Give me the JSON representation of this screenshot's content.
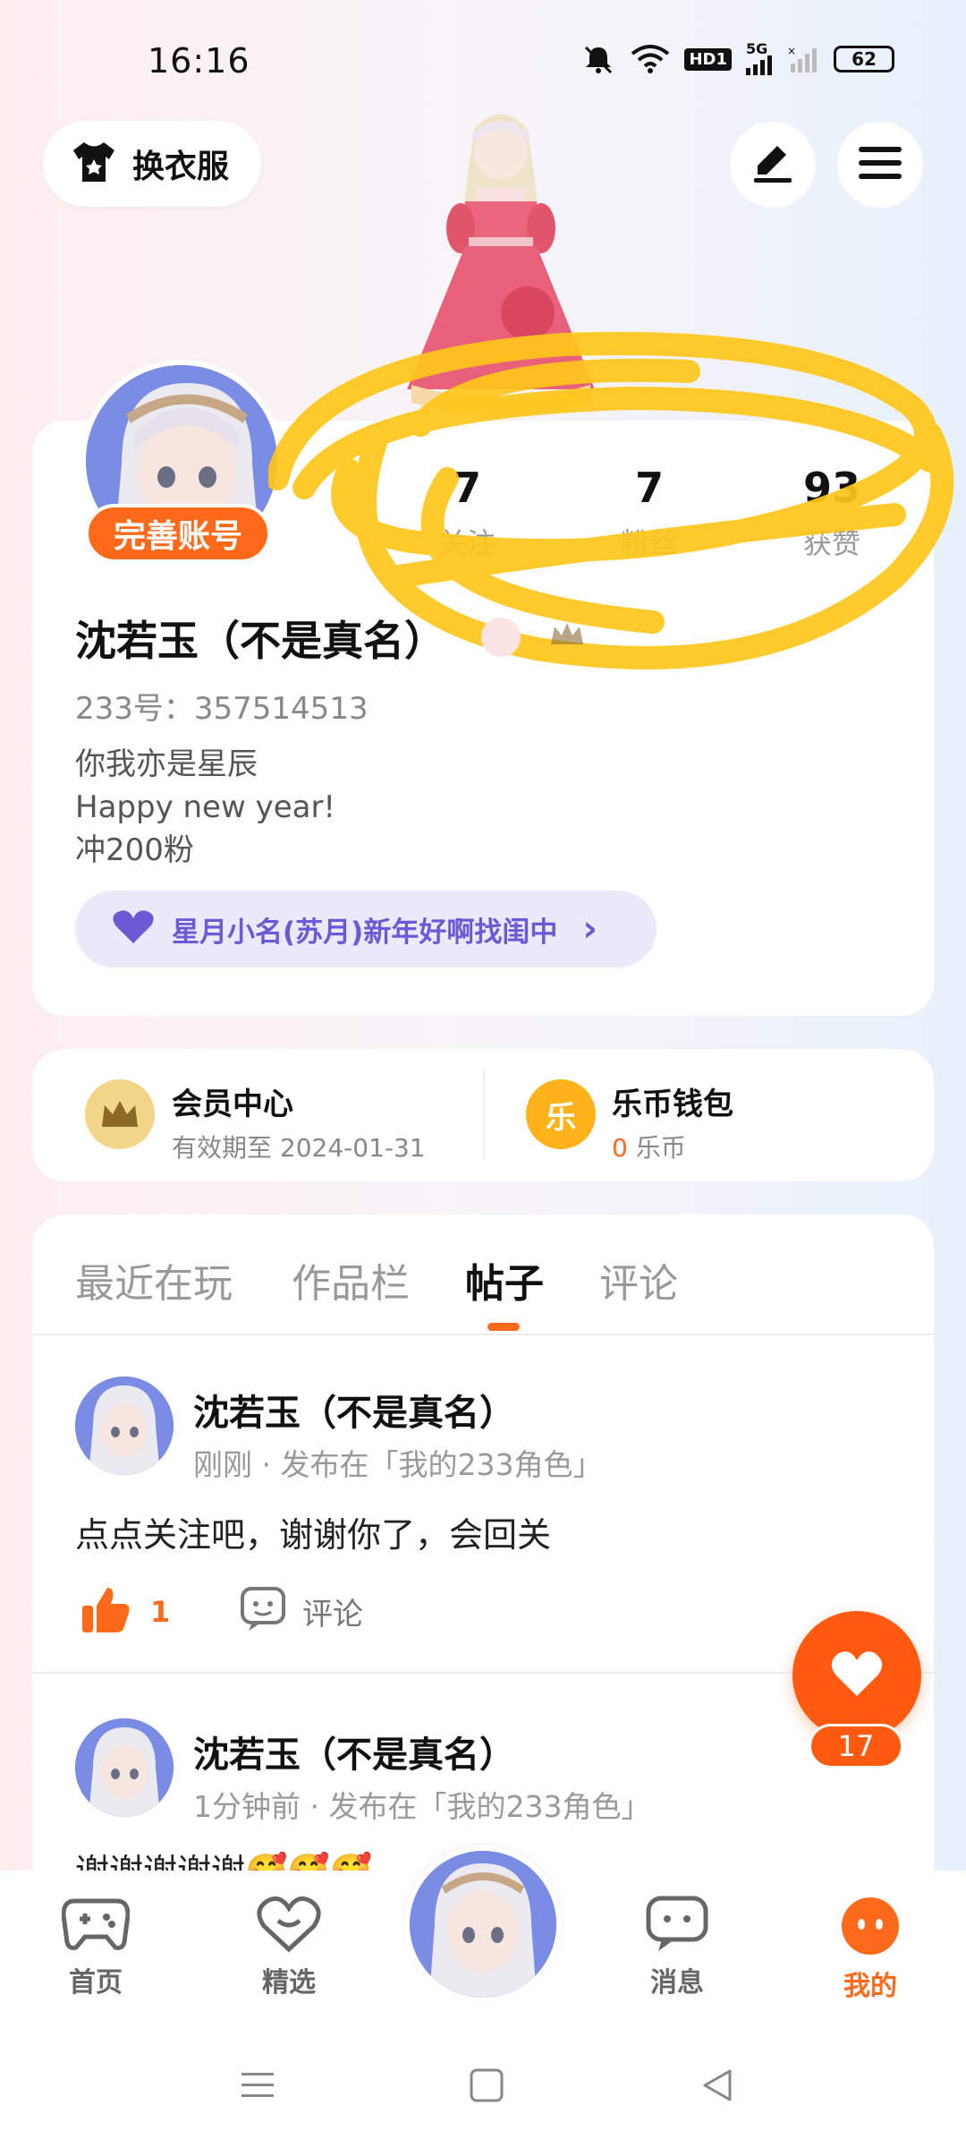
{
  "status_bar": {
    "time": "16:16",
    "icons": [
      "mute-icon",
      "wifi-icon",
      "hd-icon",
      "signal-5g-icon",
      "signal-icon"
    ],
    "hd_label": "HD1",
    "network_label": "5G",
    "battery": "62"
  },
  "top": {
    "outfit_label": "换衣服",
    "edit_icon": "pen-icon",
    "menu_icon": "hamburger-icon"
  },
  "profile": {
    "complete_label": "完善账号",
    "stats": [
      {
        "value": "7",
        "label": "关注"
      },
      {
        "value": "7",
        "label": "粉丝"
      },
      {
        "value": "93",
        "label": "获赞"
      }
    ],
    "name": "沈若玉（不是真名）",
    "id_line": "233号：357514513",
    "bio": [
      "你我亦是星辰",
      "Happy new year!",
      "冲200粉"
    ],
    "group_label": "星月小名(苏月)新年好啊找闺中",
    "group_chevron": "›"
  },
  "vip": {
    "member_title": "会员中心",
    "member_sub": "有效期至 2024-01-31",
    "wallet_title": "乐币钱包",
    "wallet_amount": "0",
    "wallet_unit": "乐币",
    "wallet_icon_char": "乐"
  },
  "tabs": [
    "最近在玩",
    "作品栏",
    "帖子",
    "评论"
  ],
  "active_tab": "帖子",
  "posts": [
    {
      "author": "沈若玉（不是真名）",
      "meta": "刚刚 · 发布在「我的233角色」",
      "body": "点点关注吧，谢谢你了，会回关",
      "likes": "1",
      "comment_label": "评论"
    },
    {
      "author": "沈若玉（不是真名）",
      "meta": "1分钟前 · 发布在「我的233角色」",
      "body": "谢谢谢谢谢🥰🥰🥰"
    }
  ],
  "fab": {
    "count": "17"
  },
  "bottom_nav": [
    {
      "label": "首页",
      "icon": "gamepad-icon"
    },
    {
      "label": "精选",
      "icon": "heart-chat-icon"
    },
    {
      "label": "消息",
      "icon": "chat-bubble-icon"
    },
    {
      "label": "我的",
      "icon": "face-icon"
    }
  ],
  "colors": {
    "accent": "#ff6a1a",
    "purple": "#6a5ad6",
    "scribble": "#ffc61a"
  }
}
